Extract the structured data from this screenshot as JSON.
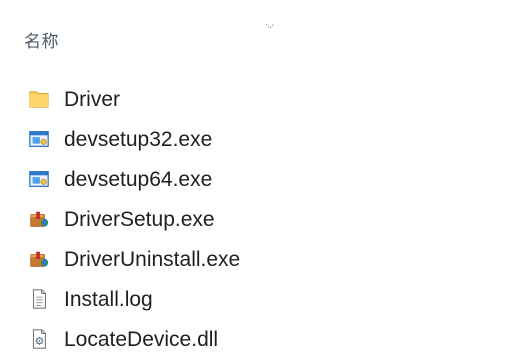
{
  "header": {
    "name_label": "名称",
    "sort_icon": "sort-indicator-icon"
  },
  "files": [
    {
      "name": "Driver",
      "icon": "folder-icon"
    },
    {
      "name": "devsetup32.exe",
      "icon": "setup-exe-icon"
    },
    {
      "name": "devsetup64.exe",
      "icon": "setup-exe-icon"
    },
    {
      "name": "DriverSetup.exe",
      "icon": "installer-package-icon"
    },
    {
      "name": "DriverUninstall.exe",
      "icon": "installer-package-icon"
    },
    {
      "name": "Install.log",
      "icon": "text-document-icon"
    },
    {
      "name": "LocateDevice.dll",
      "icon": "dll-settings-icon"
    }
  ],
  "colors": {
    "folder": "#F8C751",
    "accent_blue": "#2E79C7",
    "text": "#1F1F1F",
    "header_text": "#4F5B66"
  }
}
